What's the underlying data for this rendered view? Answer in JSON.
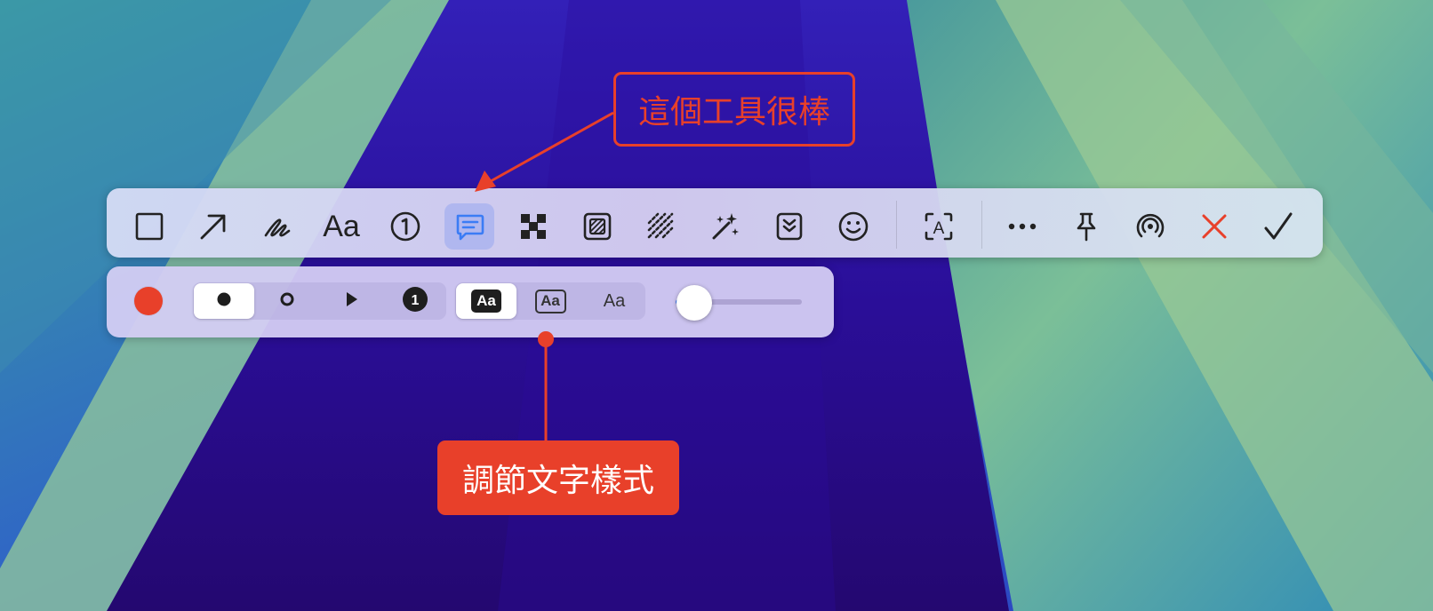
{
  "annotations": {
    "top_callout": "這個工具很棒",
    "bottom_callout": "調節文字樣式",
    "color": "#e8402a"
  },
  "toolbar": {
    "tools": [
      {
        "name": "rectangle-icon"
      },
      {
        "name": "arrow-icon"
      },
      {
        "name": "pen-icon"
      },
      {
        "name": "text-icon",
        "label": "Aa"
      },
      {
        "name": "counter-icon",
        "label": "1"
      },
      {
        "name": "speech-bubble-icon",
        "active": true
      },
      {
        "name": "pixelate-icon"
      },
      {
        "name": "blur-box-icon"
      },
      {
        "name": "hatch-icon"
      },
      {
        "name": "magic-sparkles-icon"
      },
      {
        "name": "chevron-down-box-icon"
      },
      {
        "name": "emoji-icon"
      },
      {
        "name": "text-recognition-icon",
        "label": "A"
      },
      {
        "name": "more-icon"
      },
      {
        "name": "pin-icon"
      },
      {
        "name": "airdrop-icon"
      },
      {
        "name": "close-icon"
      },
      {
        "name": "checkmark-icon"
      }
    ],
    "accent_active": "#3b7cf5",
    "close_color": "#e8402a"
  },
  "subbar": {
    "color": "#e8402a",
    "marker_styles": [
      {
        "name": "filled-dot-icon",
        "selected": true
      },
      {
        "name": "hollow-dot-icon",
        "selected": false
      },
      {
        "name": "triangle-icon",
        "selected": false
      },
      {
        "name": "numbered-dot-icon",
        "label": "1",
        "selected": false
      }
    ],
    "text_styles": [
      {
        "name": "text-style-filled",
        "label": "Aa",
        "selected": true
      },
      {
        "name": "text-style-outline",
        "label": "Aa",
        "selected": false
      },
      {
        "name": "text-style-plain",
        "label": "Aa",
        "selected": false
      }
    ],
    "size_slider": {
      "value": 0.15
    }
  }
}
